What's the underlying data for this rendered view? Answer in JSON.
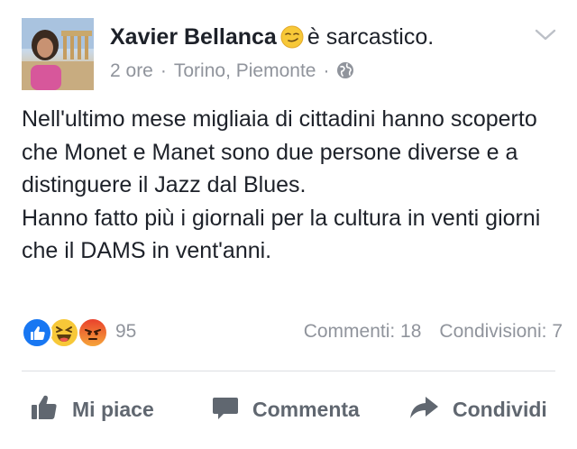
{
  "post": {
    "author": "Xavier Bellanca",
    "feeling_text": "è sarcastico.",
    "feeling_icon": "smirk-emoji-icon",
    "time": "2 ore",
    "location": "Torino, Piemonte",
    "separator": "·",
    "privacy_icon": "globe-icon",
    "body_lines": [
      "Nell'ultimo mese migliaia di cittadini hanno scoperto che Monet e Manet sono due persone diverse e a distinguere il Jazz dal Blues.",
      "Hanno fatto più i giornali per la cultura in venti giorni che il DAMS in vent'anni."
    ]
  },
  "reactions": {
    "icons": [
      "like-reaction-icon",
      "haha-reaction-icon",
      "angry-reaction-icon"
    ],
    "count": "95",
    "comments": "Commenti: 18",
    "shares": "Condivisioni: 7"
  },
  "actions": {
    "like": "Mi piace",
    "comment": "Commenta",
    "share": "Condividi"
  },
  "colors": {
    "text": "#1d2129",
    "secondary": "#90949c",
    "action": "#606770",
    "like_blue": "#1877f2",
    "haha_yellow": "#f7b928",
    "angry_red": "#e9710f"
  }
}
